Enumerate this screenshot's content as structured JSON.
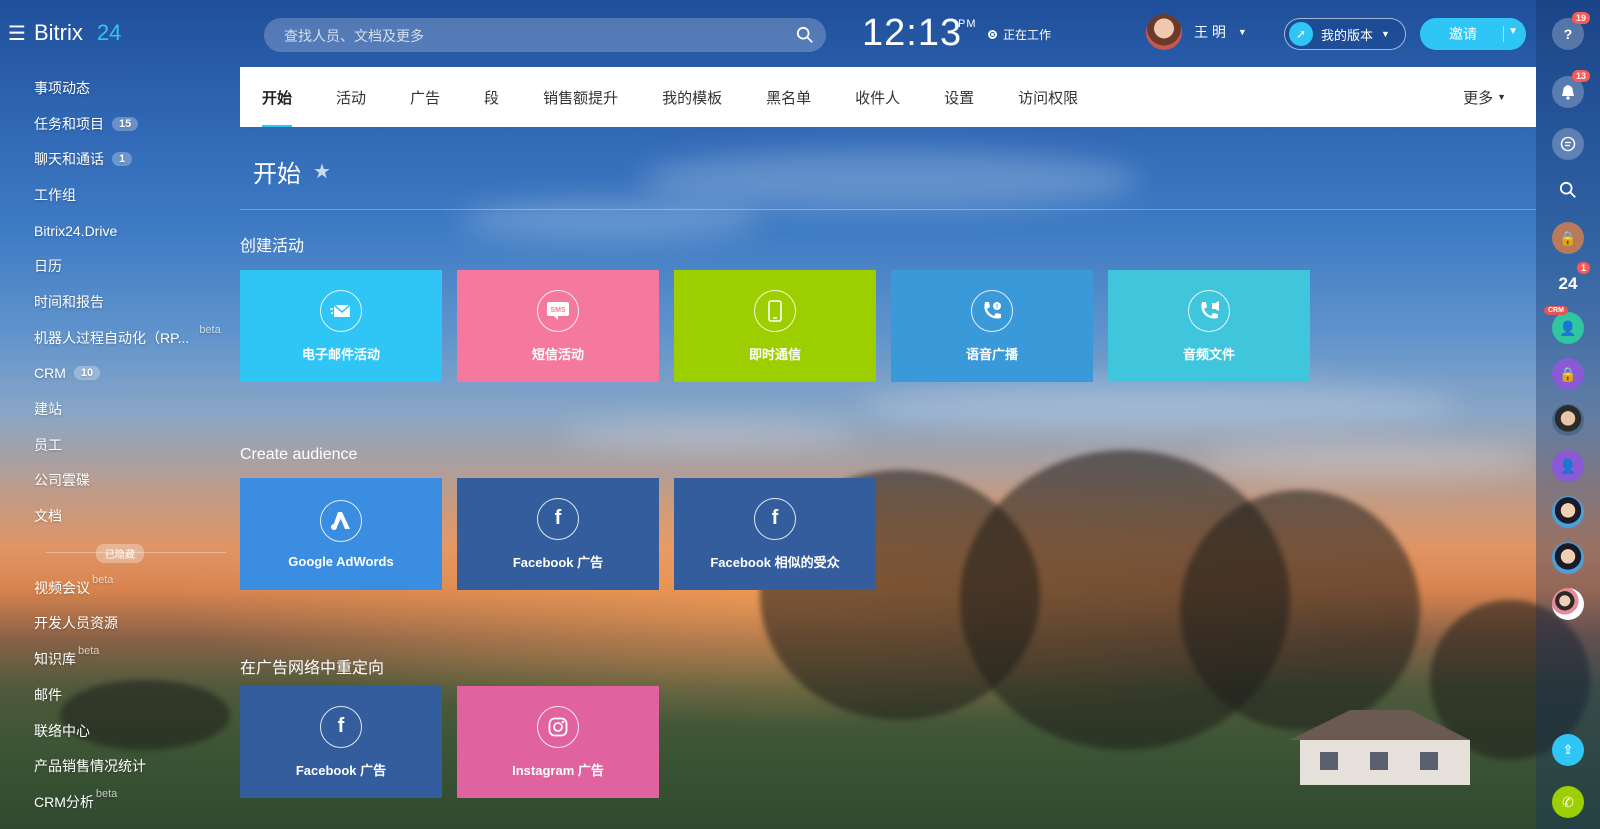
{
  "header": {
    "logo_text": "Bitrix",
    "logo_number": "24",
    "search_placeholder": "查找人员、文档及更多",
    "clock_time": "12:13",
    "clock_ampm": "PM",
    "work_status": "正在工作",
    "user_name": "王 明",
    "version_label": "我的版本",
    "invite_label": "邀请"
  },
  "sidebar": {
    "items": [
      {
        "label": "事项动态"
      },
      {
        "label": "任务和项目",
        "badge": "15"
      },
      {
        "label": "聊天和通话",
        "badge": "1"
      },
      {
        "label": "工作组"
      },
      {
        "label": "Bitrix24.Drive"
      },
      {
        "label": "日历"
      },
      {
        "label": "时间和报告"
      },
      {
        "label": "机器人过程自动化（RP...",
        "beta": "beta"
      },
      {
        "label": "CRM",
        "badge": "10"
      },
      {
        "label": "建站"
      },
      {
        "label": "员工"
      },
      {
        "label": "公司雲碟"
      },
      {
        "label": "文档"
      }
    ],
    "hidden_label": "已隐藏",
    "hidden_items": [
      {
        "label": "视频会议",
        "beta": "beta"
      },
      {
        "label": "开发人员资源"
      },
      {
        "label": "知识库",
        "beta": "beta"
      },
      {
        "label": "邮件"
      },
      {
        "label": "联络中心"
      },
      {
        "label": "产品销售情况统计"
      },
      {
        "label": "CRM分析",
        "beta": "beta"
      }
    ]
  },
  "tabs": [
    {
      "label": "开始",
      "active": true
    },
    {
      "label": "活动"
    },
    {
      "label": "广告"
    },
    {
      "label": "段"
    },
    {
      "label": "销售额提升"
    },
    {
      "label": "我的模板"
    },
    {
      "label": "黑名单"
    },
    {
      "label": "收件人"
    },
    {
      "label": "设置"
    },
    {
      "label": "访问权限"
    }
  ],
  "tab_more": "更多",
  "page_title": "开始",
  "sections": [
    {
      "title": "创建活动",
      "tiles": [
        {
          "label": "电子邮件活动",
          "icon": "email-icon",
          "color": "#2fc6f6"
        },
        {
          "label": "短信活动",
          "icon": "sms-icon",
          "color": "#f5799e"
        },
        {
          "label": "即时通信",
          "icon": "phone-icon",
          "color": "#9dcf00"
        },
        {
          "label": "语音广播",
          "icon": "call-icon",
          "color": "#3a9ad9"
        },
        {
          "label": "音频文件",
          "icon": "audio-call-icon",
          "color": "#3fc6dc"
        }
      ]
    },
    {
      "title": "Create audience",
      "tiles": [
        {
          "label": "Google AdWords",
          "icon": "adwords-icon",
          "color": "#3a8de0"
        },
        {
          "label": "Facebook 广告",
          "icon": "facebook-icon",
          "color": "#345d9d"
        },
        {
          "label": "Facebook 相似的受众",
          "icon": "facebook-icon",
          "color": "#345d9d"
        }
      ]
    },
    {
      "title": "在广告网络中重定向",
      "tiles": [
        {
          "label": "Facebook 广告",
          "icon": "facebook-icon",
          "color": "#345d9d"
        },
        {
          "label": "Instagram 广告",
          "icon": "instagram-icon",
          "color": "#e0639f"
        }
      ]
    }
  ],
  "rail": {
    "help_count": "19",
    "notify_count": "13",
    "tasks_count": "1",
    "tasks_label": "24",
    "crm_tag": "CRM"
  }
}
